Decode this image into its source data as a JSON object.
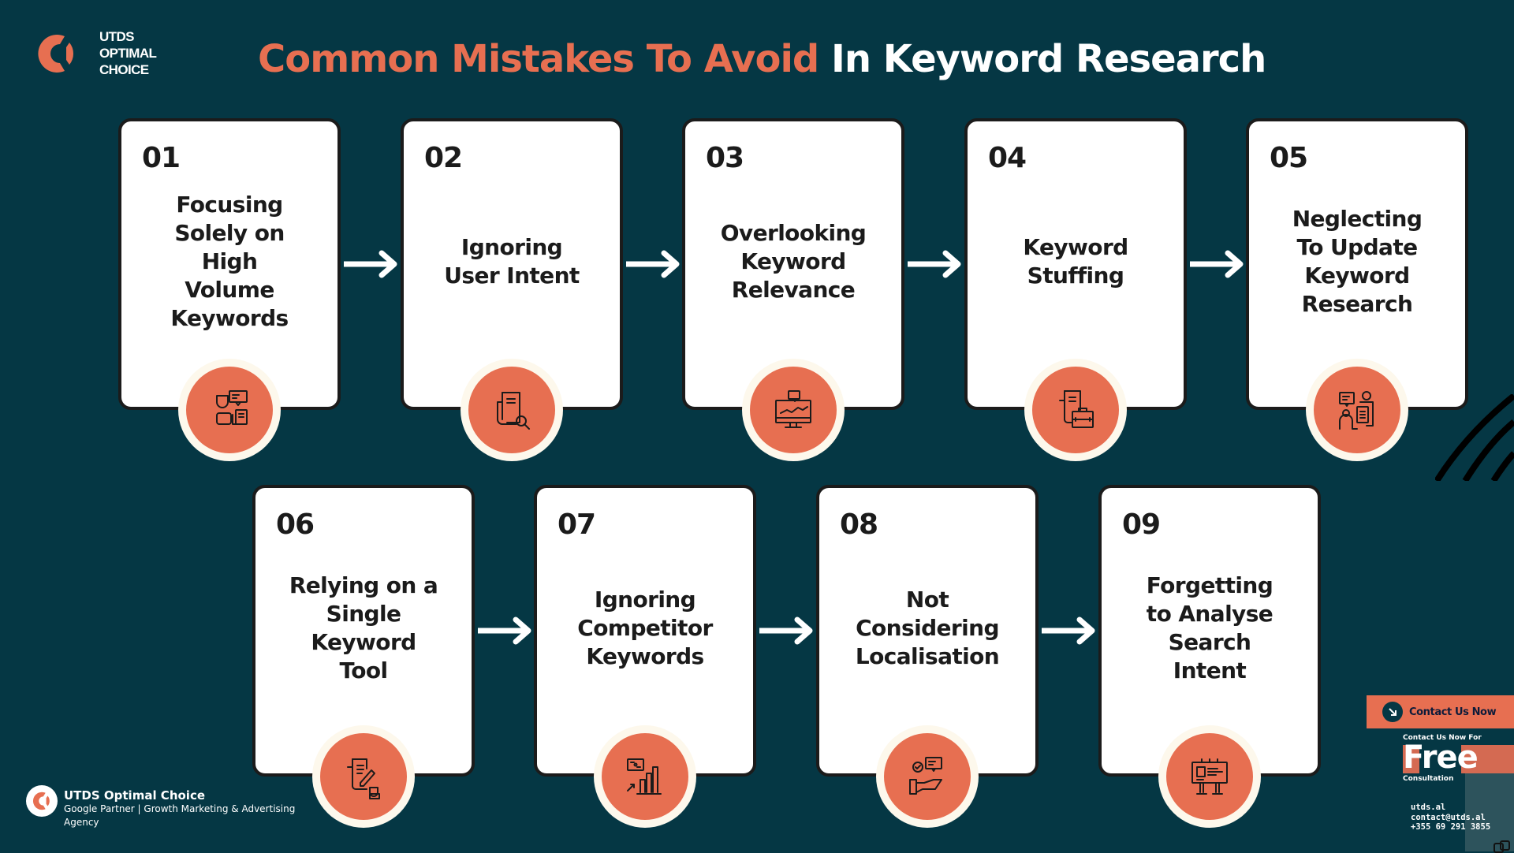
{
  "brand": {
    "logo_lines": [
      "UTDS",
      "OPTIMAL",
      "CHOICE"
    ],
    "colors": {
      "background": "#053744",
      "accent": "#E76F51",
      "cream": "#FDF8EC",
      "card": "#FFFFFF",
      "ink": "#1B1B1B"
    }
  },
  "title": {
    "accent": "Common Mistakes To Avoid",
    "rest": " In Keyword Research"
  },
  "cards": [
    {
      "num": "01",
      "label": "Focusing\nSolely on\nHigh\nVolume\nKeywords",
      "icon": "people-chat-icon"
    },
    {
      "num": "02",
      "label": "Ignoring\nUser Intent",
      "icon": "document-search-icon"
    },
    {
      "num": "03",
      "label": "Overlooking\nKeyword\nRelevance",
      "icon": "monitor-chart-icon"
    },
    {
      "num": "04",
      "label": "Keyword\nStuffing",
      "icon": "document-briefcase-icon"
    },
    {
      "num": "05",
      "label": "Neglecting\nTo Update\nKeyword\nResearch",
      "icon": "people-conversation-icon"
    },
    {
      "num": "06",
      "label": "Relying on a\nSingle\nKeyword\nTool",
      "icon": "document-pen-user-icon"
    },
    {
      "num": "07",
      "label": "Ignoring\nCompetitor\nKeywords",
      "icon": "bar-chart-growth-icon"
    },
    {
      "num": "08",
      "label": "Not\nConsidering\nLocalisation",
      "icon": "hand-check-chat-icon"
    },
    {
      "num": "09",
      "label": "Forgetting\nto Analyse\nSearch\nIntent",
      "icon": "billboard-icon"
    }
  ],
  "footer": {
    "name": "UTDS Optimal Choice",
    "tagline": "Google Partner | Growth Marketing & Advertising Agency"
  },
  "contact": {
    "button_label": "Contact Us Now",
    "promo_top": "Contact Us Now For",
    "promo_big": "Free",
    "promo_bottom": "Consultation",
    "website": "utds.al",
    "email": "contact@utds.al",
    "phone": "+355 69 291 3855"
  }
}
